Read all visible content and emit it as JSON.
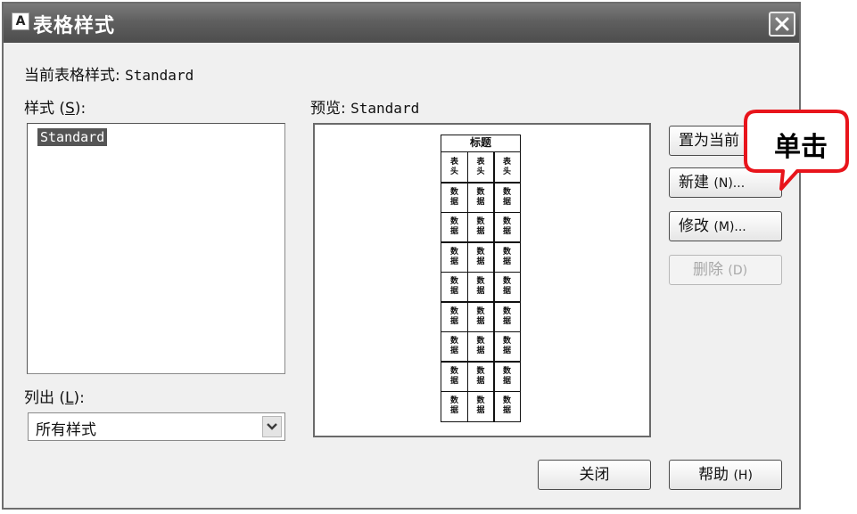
{
  "window": {
    "title": "表格样式",
    "app_icon_letter": "A"
  },
  "current_style": {
    "label": "当前表格样式:",
    "value": "Standard"
  },
  "styles": {
    "label_text": "样式",
    "label_key": "S",
    "label_colon": ":",
    "items": [
      "Standard"
    ]
  },
  "preview": {
    "label": "预览:",
    "value": "Standard",
    "table": {
      "title": "标题",
      "header_cell": [
        "表",
        "头"
      ],
      "data_cell": [
        "数",
        "据"
      ],
      "columns": 3,
      "data_rows": 8
    }
  },
  "list_filter": {
    "label_text": "列出",
    "label_key": "L",
    "label_colon": ":",
    "value": "所有样式"
  },
  "buttons": {
    "set_current": "置为当前",
    "new_text": "新建",
    "new_key": "(N)...",
    "modify_text": "修改",
    "modify_key": "(M)...",
    "delete_text": "删除",
    "delete_key": "(D)",
    "close": "关闭",
    "help_text": "帮助",
    "help_key": "(H)"
  },
  "annotation": {
    "callout_text": "单击",
    "callout_color": "#e8141b"
  },
  "icons": {
    "close": "close-x-icon",
    "dropdown": "chevron-down-icon"
  }
}
